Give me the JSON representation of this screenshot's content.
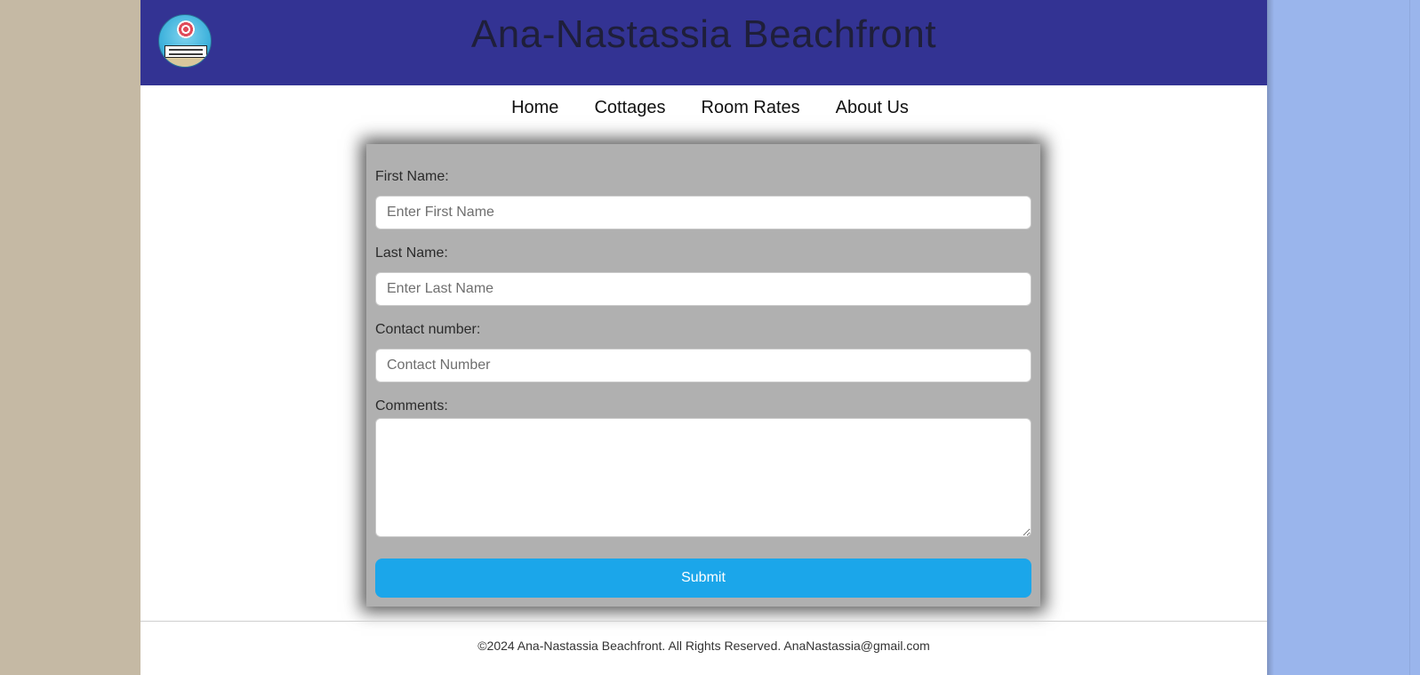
{
  "colors": {
    "header_bg": "#333393",
    "left_bg": "#c5b9a4",
    "right_bg": "#9ab5ec",
    "form_bg": "#b0b0b0",
    "submit_bg": "#1ba6ea"
  },
  "header": {
    "logo_icon": "beach-umbrella-logo-icon",
    "title": "Ana-Nastassia Beachfront"
  },
  "nav": {
    "items": [
      "Home",
      "Cottages",
      "Room Rates",
      "About Us"
    ]
  },
  "form": {
    "first_name": {
      "label": "First Name:",
      "placeholder": "Enter First Name"
    },
    "last_name": {
      "label": "Last Name:",
      "placeholder": "Enter Last Name"
    },
    "contact": {
      "label": "Contact number:",
      "placeholder": "Contact Number"
    },
    "comments": {
      "label": "Comments:"
    },
    "submit_label": "Submit"
  },
  "footer": {
    "text": "©2024 Ana-Nastassia Beachfront. All Rights Reserved. AnaNastassia@gmail.com"
  }
}
